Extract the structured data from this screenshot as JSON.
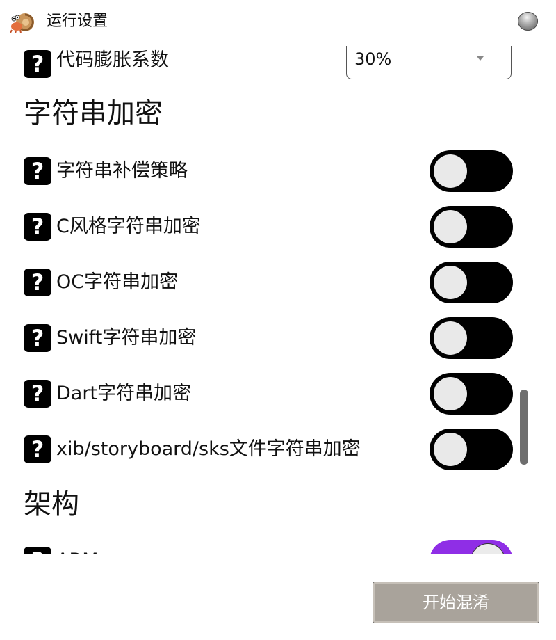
{
  "window": {
    "title": "运行设置"
  },
  "settings": {
    "code_inflation": {
      "label": "代码膨胀系数",
      "value": "30%"
    },
    "string_encryption": {
      "section_title": "字符串加密",
      "items": [
        {
          "label": "字符串补偿策略",
          "enabled": false
        },
        {
          "label": "C风格字符串加密",
          "enabled": false
        },
        {
          "label": "OC字符串加密",
          "enabled": false
        },
        {
          "label": "Swift字符串加密",
          "enabled": false
        },
        {
          "label": "Dart字符串加密",
          "enabled": false
        },
        {
          "label": "xib/storyboard/sks文件字符串加密",
          "enabled": false
        }
      ]
    },
    "architecture": {
      "section_title": "架构",
      "items": [
        {
          "label": "ARM",
          "enabled": true
        }
      ]
    }
  },
  "footer": {
    "start_button_label": "开始混淆"
  },
  "icons": {
    "app_logo": "hermit-crab-icon",
    "window_control": "gray-orb-icon",
    "help": "question-mark-icon"
  },
  "colors": {
    "toggle_on": "#8f2ee6",
    "toggle_off": "#000000",
    "start_button": "#a9a39b"
  }
}
